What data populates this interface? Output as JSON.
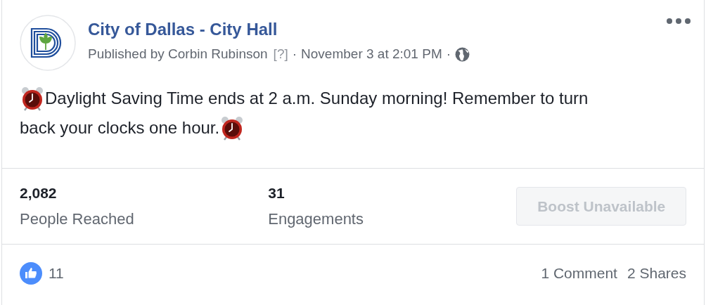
{
  "page": {
    "name": "City of Dallas - City Hall",
    "publisher": "Published by Corbin Rubinson",
    "help_mark": "[?]",
    "separator_1": "·",
    "date": "November 3 at 2:01 PM",
    "separator_2": "·"
  },
  "post": {
    "lines": [
      "Daylight Saving Time ends at 2 a.m. Sunday morning! Remember to turn",
      "back your clocks one hour."
    ]
  },
  "stats": [
    {
      "value": "2,082",
      "label": "People Reached"
    },
    {
      "value": "31",
      "label": "Engagements"
    }
  ],
  "boost_button": {
    "label": "Boost Unavailable",
    "disabled": true
  },
  "footer": {
    "likes": "11",
    "comments": "1 Comment",
    "shares": "2 Shares"
  }
}
